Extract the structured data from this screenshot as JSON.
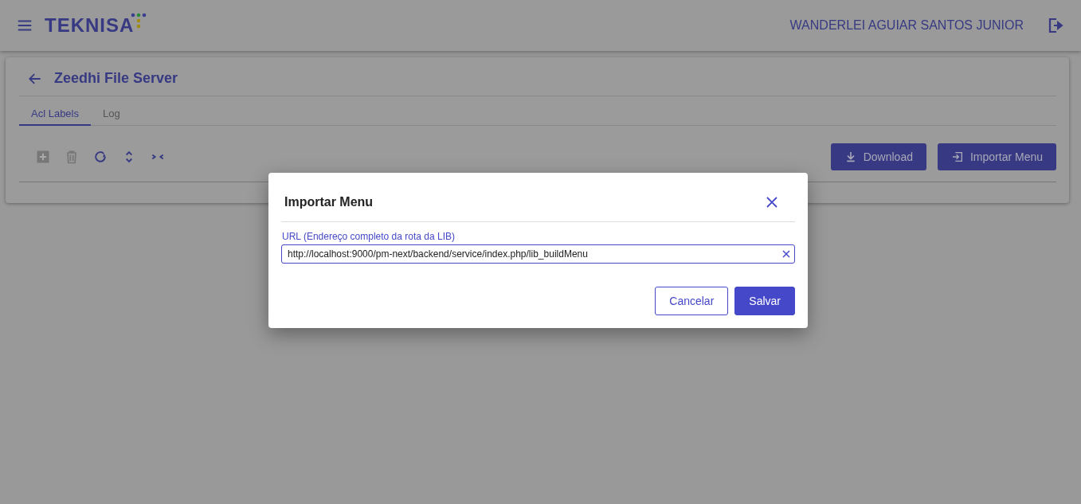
{
  "header": {
    "brand": "TEKNISA",
    "user": "WANDERLEI AGUIAR SANTOS JUNIOR"
  },
  "page": {
    "title": "Zeedhi File Server",
    "tabs": [
      {
        "label": "Acl Labels",
        "selected": true
      },
      {
        "label": "Log",
        "selected": false
      }
    ],
    "toolbar": [
      {
        "kind": "add",
        "disabled": true
      },
      {
        "kind": "delete",
        "disabled": true
      },
      {
        "kind": "refresh",
        "disabled": false
      },
      {
        "kind": "expand",
        "disabled": false
      },
      {
        "kind": "collapse",
        "disabled": false
      }
    ],
    "actions": [
      {
        "kind": "download",
        "label": "Download"
      },
      {
        "kind": "import",
        "label": "Importar Menu"
      }
    ]
  },
  "dialog": {
    "title": "Importar Menu",
    "field": {
      "label": "URL (Endereço completo da rota da LIB)",
      "value": "http://localhost:9000/pm-next/backend/service/index.php/lib_buildMenu"
    },
    "buttons": [
      {
        "kind": "outline",
        "label": "Cancelar"
      },
      {
        "kind": "primary",
        "label": "Salvar"
      }
    ]
  }
}
